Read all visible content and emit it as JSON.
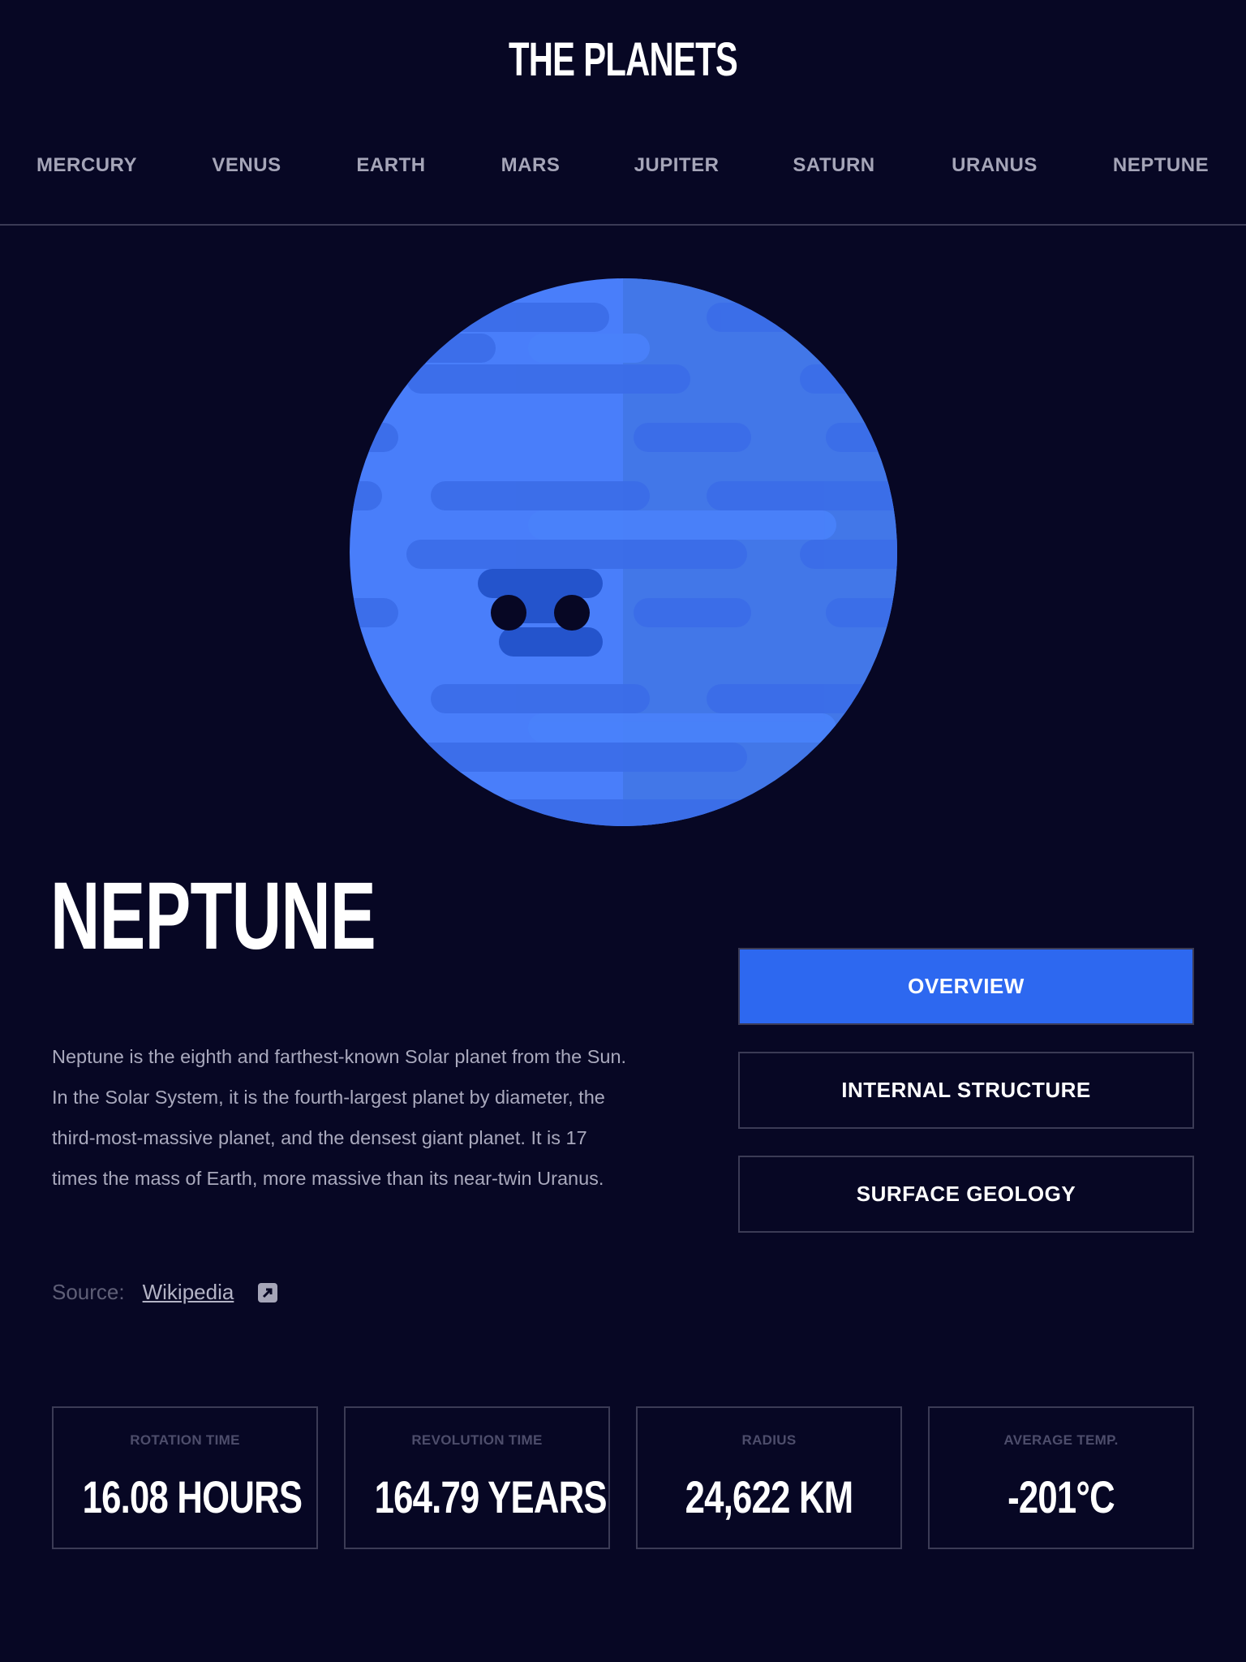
{
  "header": {
    "logo": "THE PLANETS",
    "nav": [
      "MERCURY",
      "VENUS",
      "EARTH",
      "MARS",
      "JUPITER",
      "SATURN",
      "URANUS",
      "NEPTUNE"
    ]
  },
  "planet": {
    "name": "NEPTUNE",
    "description": "Neptune is the eighth and farthest-known Solar planet from the Sun. In the Solar System, it is the fourth-largest planet by diameter, the third-most-massive planet, and the densest giant planet. It is 17 times the mass of Earth, more massive than its near-twin Uranus.",
    "source_label": "Source:",
    "source_link": "Wikipedia",
    "source_icon": "external-link-icon",
    "color": "#497efa"
  },
  "tabs": {
    "overview": "OVERVIEW",
    "internal": "INTERNAL STRUCTURE",
    "surface": "SURFACE GEOLOGY",
    "active": "OVERVIEW",
    "active_color": "#2d68f0"
  },
  "stats": [
    {
      "label": "ROTATION TIME",
      "value": "16.08 HOURS"
    },
    {
      "label": "REVOLUTION TIME",
      "value": "164.79 YEARS"
    },
    {
      "label": "RADIUS",
      "value": "24,622 KM"
    },
    {
      "label": "AVERAGE TEMP.",
      "value": "-201°C"
    }
  ]
}
